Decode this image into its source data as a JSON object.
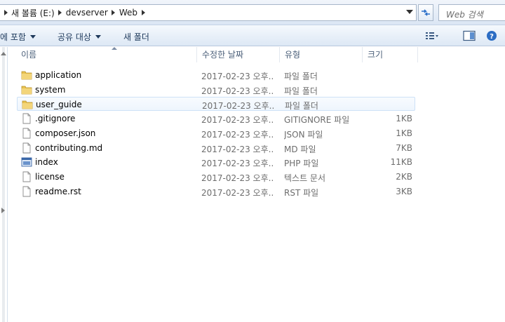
{
  "address_bar": {
    "crumbs": [
      "새 볼륨 (E:)",
      "devserver",
      "Web"
    ]
  },
  "search": {
    "placeholder": "Web 검색"
  },
  "toolbar": {
    "include_label": "에 포함",
    "share_label": "공유 대상",
    "new_folder_label": "새 폴더"
  },
  "columns": {
    "name": "이름",
    "date": "수정한 날짜",
    "type": "유형",
    "size": "크기"
  },
  "files": [
    {
      "name": "application",
      "date": "2017-02-23 오후...",
      "type": "파일 폴더",
      "size": "",
      "icon": "folder-icon"
    },
    {
      "name": "system",
      "date": "2017-02-23 오후...",
      "type": "파일 폴더",
      "size": "",
      "icon": "folder-icon"
    },
    {
      "name": "user_guide",
      "date": "2017-02-23 오후...",
      "type": "파일 폴더",
      "size": "",
      "icon": "folder-icon"
    },
    {
      "name": ".gitignore",
      "date": "2017-02-23 오후...",
      "type": "GITIGNORE 파일",
      "size": "1KB",
      "icon": "file-icon"
    },
    {
      "name": "composer.json",
      "date": "2017-02-23 오후...",
      "type": "JSON 파일",
      "size": "1KB",
      "icon": "file-icon"
    },
    {
      "name": "contributing.md",
      "date": "2017-02-23 오후...",
      "type": "MD 파일",
      "size": "7KB",
      "icon": "file-icon"
    },
    {
      "name": "index",
      "date": "2017-02-23 오후...",
      "type": "PHP 파일",
      "size": "11KB",
      "icon": "php-file-icon"
    },
    {
      "name": "license",
      "date": "2017-02-23 오후...",
      "type": "텍스트 문서",
      "size": "2KB",
      "icon": "file-icon"
    },
    {
      "name": "readme.rst",
      "date": "2017-02-23 오후...",
      "type": "RST 파일",
      "size": "3KB",
      "icon": "file-icon"
    }
  ],
  "selected_index": 2,
  "colors": {
    "folder": "#e8c250",
    "selection_border": "#cde1f7",
    "header_text": "#4c607a"
  }
}
